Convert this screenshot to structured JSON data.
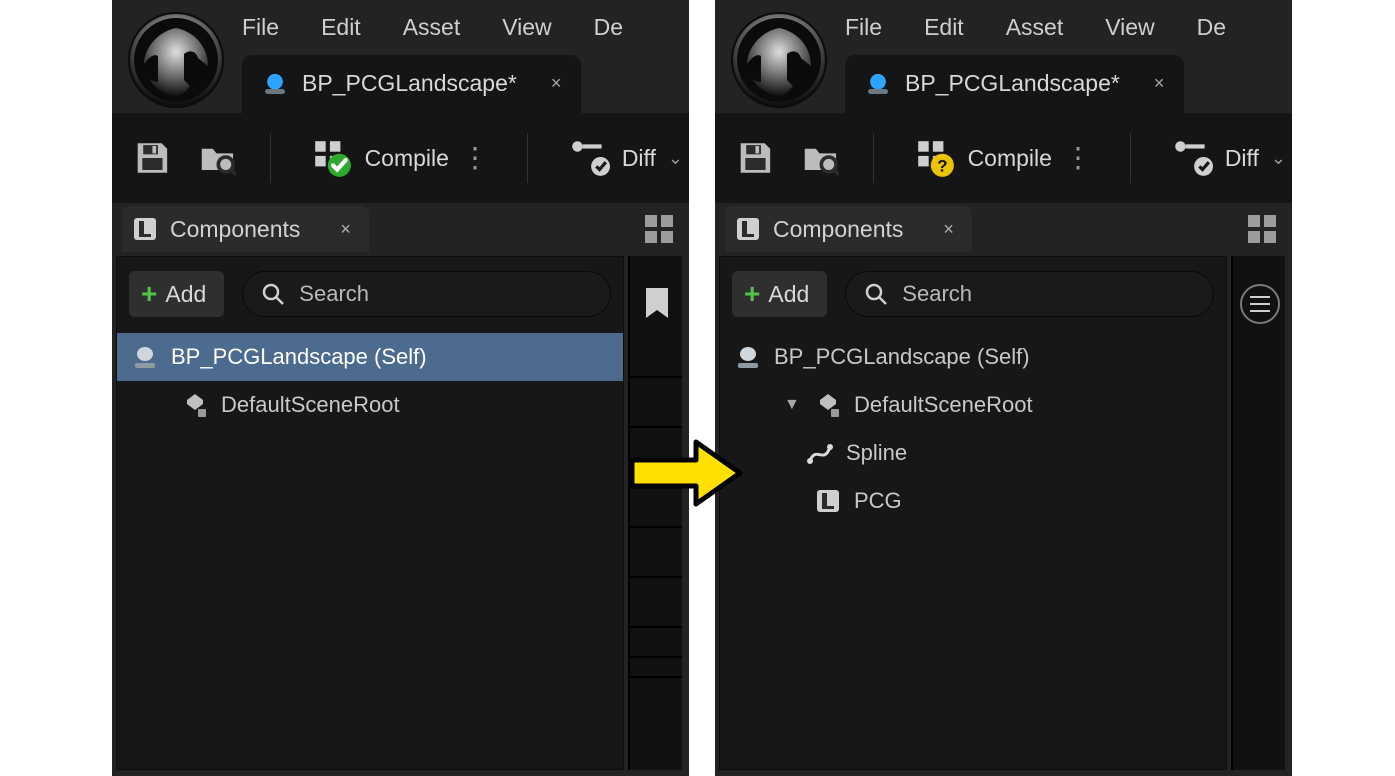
{
  "menu": {
    "file": "File",
    "edit": "Edit",
    "asset": "Asset",
    "view": "View",
    "debug": "De"
  },
  "tab": {
    "title": "BP_PCGLandscape*",
    "close": "×"
  },
  "toolbar": {
    "compile": "Compile",
    "diff": "Diff",
    "dots": "⋮",
    "caret": "⌄"
  },
  "components": {
    "panel_title": "Components",
    "close": "×",
    "add": "Add",
    "search_placeholder": "Search"
  },
  "left_tree": {
    "self": "BP_PCGLandscape (Self)",
    "root": "DefaultSceneRoot"
  },
  "right_tree": {
    "self": "BP_PCGLandscape (Self)",
    "root": "DefaultSceneRoot",
    "spline": "Spline",
    "pcg": "PCG"
  }
}
